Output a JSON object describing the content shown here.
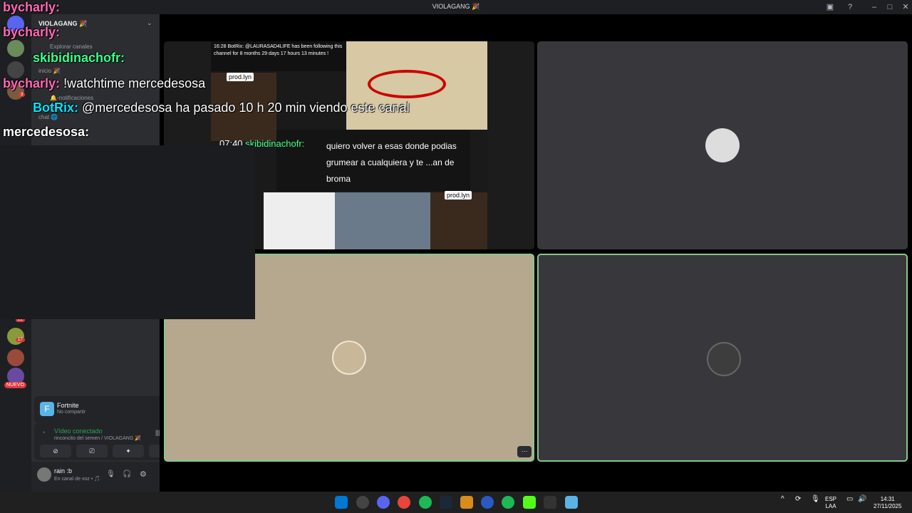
{
  "window": {
    "title": "VIOLAGANG 🎉"
  },
  "server": {
    "name": "VIOLAGANG 🎉"
  },
  "channels": [
    {
      "label": "Explorar canales"
    },
    {
      "label": "inicio 🎉"
    },
    {
      "label": "chat 🌐"
    },
    {
      "label": "🔔-notificaciones"
    }
  ],
  "chat_overlay": {
    "lines": [
      {
        "user": "bycharly:",
        "text": "",
        "color": "#ff69b4"
      },
      {
        "user": "bycharly:",
        "text": "",
        "color": "#ff69b4"
      },
      {
        "user": "skibidinachofr:",
        "text": "",
        "color": "#3cff8a"
      },
      {
        "user": "bycharly:",
        "text": "!watchtime mercedesosa",
        "color": "#ff69b4"
      },
      {
        "user": "BotRix:",
        "text": "@mercedesosa ha pasado 10 h 20 min viendo este canal",
        "color": "#00e5ff"
      },
      {
        "user": "mercedesosa:",
        "text": "",
        "color": "#ffffff"
      }
    ]
  },
  "screenshare": {
    "chat_top": "16:28 BotRix: @LAURASAD4LIFE has been following this channel for 8 months 29 days 17 hours 13 minutes !",
    "label1": "prod.lyn",
    "label2": "prod.lyn",
    "msg_time": "07:40",
    "msg_user": "skibidinachofr:",
    "msg_text": "quiero volver a esas donde podias grumear a cualquiera y te ...an de broma"
  },
  "activity": {
    "title": "Fortnite",
    "subtitle": "No compartir"
  },
  "voice": {
    "status": "Vídeo conectado",
    "channel": "rinconcito del semen / VIOLAGANG 🎉"
  },
  "user": {
    "name": "rain :b",
    "status": "En canal de voz • 🎵"
  },
  "badges": {
    "b1": "3",
    "b2": "21",
    "b3": "17",
    "new": "NUEVO"
  },
  "taskbar": {
    "lang1": "ESP",
    "lang2": "LAA",
    "time": "14:31",
    "date": "27/11/2025"
  },
  "colors": {
    "accent_green": "#84c988",
    "discord_bg": "#2b2d31"
  }
}
